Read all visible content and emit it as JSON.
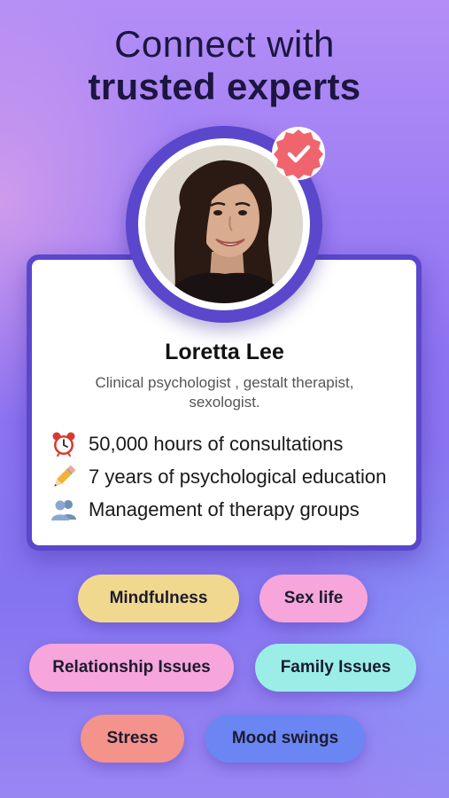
{
  "headline": {
    "line1": "Connect with",
    "line2": "trusted experts"
  },
  "expert": {
    "name": "Loretta Lee",
    "role": "Clinical psychologist , gestalt therapist, sexologist.",
    "verified": true
  },
  "facts": [
    {
      "icon": "alarm-clock-icon",
      "text": "50,000 hours of consultations"
    },
    {
      "icon": "pencil-icon",
      "text": "7 years of psychological education"
    },
    {
      "icon": "group-icon",
      "text": "Management of therapy groups"
    }
  ],
  "topics": [
    {
      "label": "Mindfulness",
      "color": "#f0d98e"
    },
    {
      "label": "Sex life",
      "color": "#f6a6da"
    },
    {
      "label": "Relationship Issues",
      "color": "#f6a6da"
    },
    {
      "label": "Family Issues",
      "color": "#9beee8"
    },
    {
      "label": "Stress",
      "color": "#f4938c"
    },
    {
      "label": "Mood swings",
      "color": "#6b86f2"
    }
  ],
  "colors": {
    "card_border": "#5a47cc",
    "badge": "#f0656d",
    "headline": "#1d1540"
  }
}
